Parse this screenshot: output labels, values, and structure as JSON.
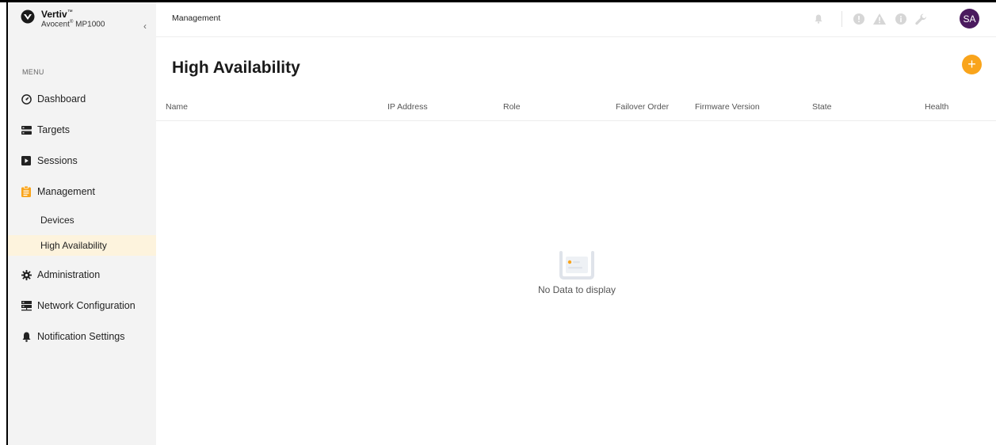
{
  "app": {
    "brand": "Vertiv",
    "brand_tm": "™",
    "product_prefix": "Avocent",
    "product_reg": "®",
    "product_name": " MP1000",
    "collapse_glyph": "‹"
  },
  "sidebar": {
    "menu_title": "MENU",
    "items": [
      {
        "label": "Dashboard",
        "icon": "dashboard-gauge-icon"
      },
      {
        "label": "Targets",
        "icon": "server-stack-icon"
      },
      {
        "label": "Sessions",
        "icon": "play-box-icon"
      },
      {
        "label": "Management",
        "icon": "clipboard-icon",
        "active_color": "#f9a41b"
      },
      {
        "label": "Administration",
        "icon": "gear-icon"
      },
      {
        "label": "Network Configuration",
        "icon": "network-icon"
      },
      {
        "label": "Notification Settings",
        "icon": "bell-icon"
      }
    ],
    "sub_items": [
      {
        "label": "Devices"
      },
      {
        "label": "High Availability",
        "selected": true
      }
    ]
  },
  "topbar": {
    "breadcrumb": "Management",
    "icons": [
      "bell-icon",
      "info-icon",
      "warning-icon",
      "info-circle-icon",
      "wrench-icon"
    ],
    "avatar": "SA",
    "avatar_color": "#4a1a5e"
  },
  "page": {
    "title": "High Availability",
    "add_label": "+",
    "accent_color": "#f9a41b"
  },
  "table": {
    "columns": [
      "Name",
      "IP Address",
      "Role",
      "Failover Order",
      "Firmware Version",
      "State",
      "Health"
    ],
    "rows": [],
    "empty_text": "No Data to display"
  }
}
